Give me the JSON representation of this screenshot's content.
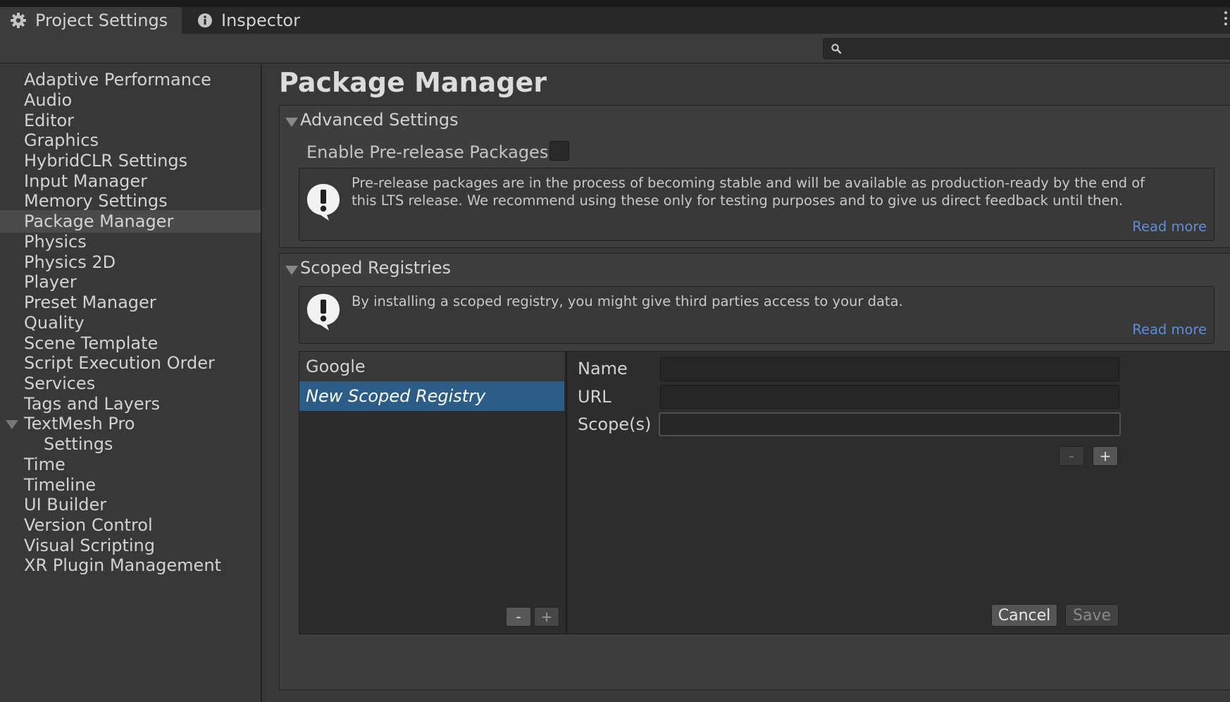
{
  "tabs": [
    {
      "label": "Project Settings",
      "icon": "gear-icon"
    },
    {
      "label": "Inspector",
      "icon": "info-icon"
    }
  ],
  "search": {
    "placeholder": "",
    "value": "",
    "icon": "search-icon"
  },
  "sidebar": {
    "items": [
      {
        "label": "Adaptive Performance"
      },
      {
        "label": "Audio"
      },
      {
        "label": "Editor"
      },
      {
        "label": "Graphics"
      },
      {
        "label": "HybridCLR Settings"
      },
      {
        "label": "Input Manager"
      },
      {
        "label": "Memory Settings"
      },
      {
        "label": "Package Manager",
        "selected": true
      },
      {
        "label": "Physics"
      },
      {
        "label": "Physics 2D"
      },
      {
        "label": "Player"
      },
      {
        "label": "Preset Manager"
      },
      {
        "label": "Quality"
      },
      {
        "label": "Scene Template"
      },
      {
        "label": "Script Execution Order"
      },
      {
        "label": "Services"
      },
      {
        "label": "Tags and Layers"
      },
      {
        "label": "TextMesh Pro",
        "expanded": true
      },
      {
        "label": "Settings",
        "child": true
      },
      {
        "label": "Time"
      },
      {
        "label": "Timeline"
      },
      {
        "label": "UI Builder"
      },
      {
        "label": "Version Control"
      },
      {
        "label": "Visual Scripting"
      },
      {
        "label": "XR Plugin Management"
      }
    ]
  },
  "main": {
    "title": "Package Manager",
    "advanced": {
      "title": "Advanced Settings",
      "toggle_label": "Enable Pre-release Packages",
      "toggle_checked": false,
      "help_text": "Pre-release packages are in the process of becoming stable and will be available as production-ready by the end of this LTS release. We recommend using these only for testing purposes and to give us direct feedback until then.",
      "read_more": "Read more"
    },
    "scoped": {
      "title": "Scoped Registries",
      "help_text": "By installing a scoped registry, you might give third parties access to your data.",
      "read_more": "Read more",
      "registries": [
        "Google",
        "New Scoped Registry"
      ],
      "selected_registry": "New Scoped Registry",
      "list_minus": "-",
      "list_plus": "+",
      "fields": {
        "name_label": "Name",
        "name_value": "",
        "url_label": "URL",
        "url_value": "",
        "scope_label": "Scope(s)",
        "scope_value": ""
      },
      "scope_minus": "-",
      "scope_plus": "+",
      "cancel_label": "Cancel",
      "save_label": "Save"
    }
  },
  "colors": {
    "selection": "#2c5d87",
    "link": "#5f8dd8",
    "panel": "#383838"
  }
}
